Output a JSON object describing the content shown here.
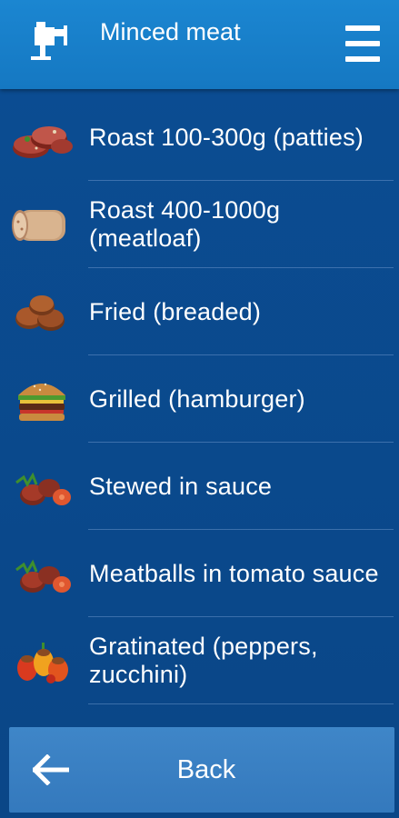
{
  "header": {
    "title": "Minced meat",
    "logo_icon": "meat-grinder-icon",
    "menu_icon": "hamburger-menu-icon",
    "color": "#1a83cd"
  },
  "items": [
    {
      "label": "Roast 100-300g (patties)",
      "icon": "patties-icon"
    },
    {
      "label": "Roast 400-1000g (meatloaf)",
      "icon": "meatloaf-icon"
    },
    {
      "label": "Fried (breaded)",
      "icon": "breaded-patties-icon"
    },
    {
      "label": "Grilled (hamburger)",
      "icon": "hamburger-icon"
    },
    {
      "label": "Stewed in sauce",
      "icon": "stewed-meat-icon"
    },
    {
      "label": "Meatballs in tomato sauce",
      "icon": "meatballs-icon"
    },
    {
      "label": "Gratinated (peppers, zucchini)",
      "icon": "stuffed-peppers-icon"
    }
  ],
  "back": {
    "label": "Back",
    "icon": "arrow-left-icon"
  },
  "colors": {
    "background": "#0a4a8e",
    "header": "#1a83cd",
    "button": "#3a80c2",
    "text": "#ffffff"
  }
}
